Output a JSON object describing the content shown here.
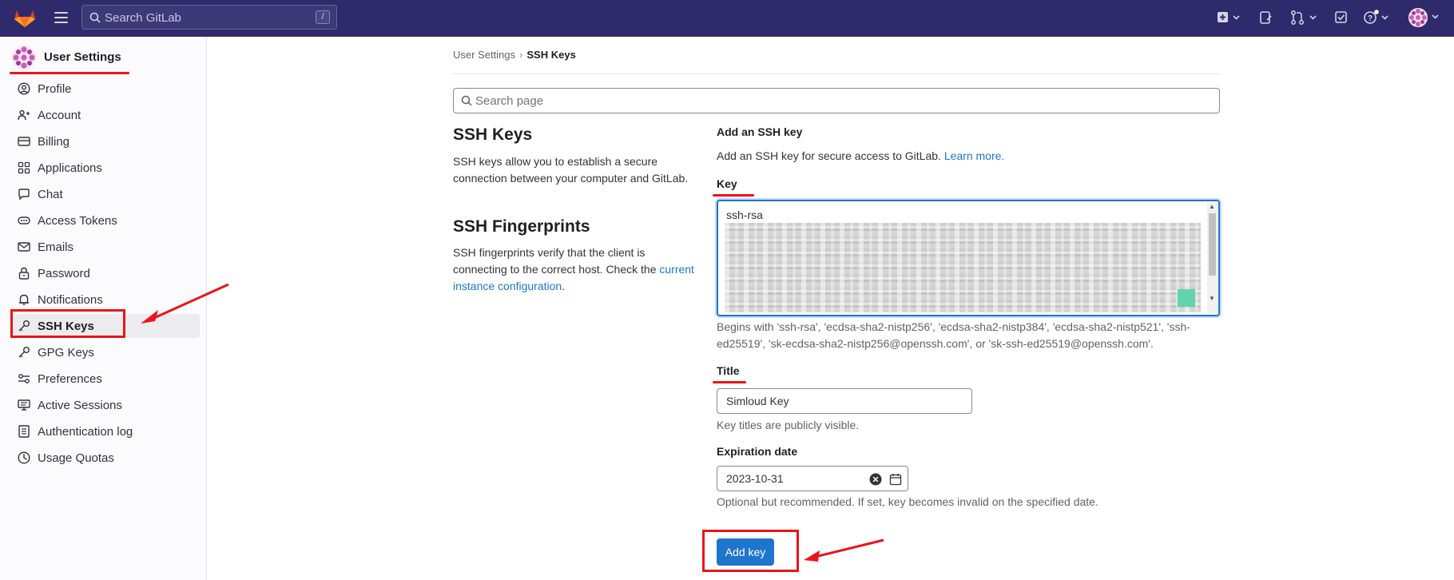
{
  "topbar": {
    "search_placeholder": "Search GitLab",
    "search_shortcut": "/",
    "icons": [
      "gitlab-logo",
      "hamburger-menu-icon",
      "search-icon",
      "new-item-icon",
      "issues-icon",
      "merge-requests-icon",
      "todo-icon",
      "help-icon",
      "user-avatar"
    ],
    "background": "#2f2a6b"
  },
  "sidebar": {
    "title": "User Settings",
    "items": [
      {
        "label": "Profile",
        "icon": "profile-icon"
      },
      {
        "label": "Account",
        "icon": "account-icon"
      },
      {
        "label": "Billing",
        "icon": "billing-icon"
      },
      {
        "label": "Applications",
        "icon": "applications-icon"
      },
      {
        "label": "Chat",
        "icon": "chat-icon"
      },
      {
        "label": "Access Tokens",
        "icon": "token-icon"
      },
      {
        "label": "Emails",
        "icon": "email-icon"
      },
      {
        "label": "Password",
        "icon": "lock-icon"
      },
      {
        "label": "Notifications",
        "icon": "bell-icon"
      },
      {
        "label": "SSH Keys",
        "icon": "key-icon",
        "active": true
      },
      {
        "label": "GPG Keys",
        "icon": "key-icon"
      },
      {
        "label": "Preferences",
        "icon": "preferences-icon"
      },
      {
        "label": "Active Sessions",
        "icon": "monitor-icon"
      },
      {
        "label": "Authentication log",
        "icon": "log-icon"
      },
      {
        "label": "Usage Quotas",
        "icon": "quota-icon"
      }
    ]
  },
  "breadcrumb": {
    "parent": "User Settings",
    "separator": "›",
    "current": "SSH Keys"
  },
  "page_search": {
    "placeholder": "Search page"
  },
  "ssh_keys": {
    "heading": "SSH Keys",
    "description": "SSH keys allow you to establish a secure connection between your computer and GitLab."
  },
  "fingerprints": {
    "heading": "SSH Fingerprints",
    "description": "SSH fingerprints verify that the client is connecting to the correct host. Check the",
    "link": "current instance configuration",
    "suffix": "."
  },
  "form": {
    "title": "Add an SSH key",
    "intro": "Add an SSH key for secure access to GitLab.",
    "learn_more": "Learn more.",
    "key_label": "Key",
    "key_value": "ssh-rsa",
    "key_help": "Begins with 'ssh-rsa', 'ecdsa-sha2-nistp256', 'ecdsa-sha2-nistp384', 'ecdsa-sha2-nistp521', 'ssh-ed25519', 'sk-ecdsa-sha2-nistp256@openssh.com', or 'sk-ssh-ed25519@openssh.com'.",
    "title_label": "Title",
    "title_value": "Simloud Key",
    "title_help": "Key titles are publicly visible.",
    "expiration_label": "Expiration date",
    "expiration_value": "2023-10-31",
    "expiration_help": "Optional but recommended. If set, key becomes invalid on the specified date.",
    "submit": "Add key"
  },
  "colors": {
    "accent": "#1f75cb",
    "annotation": "#e8151b"
  }
}
